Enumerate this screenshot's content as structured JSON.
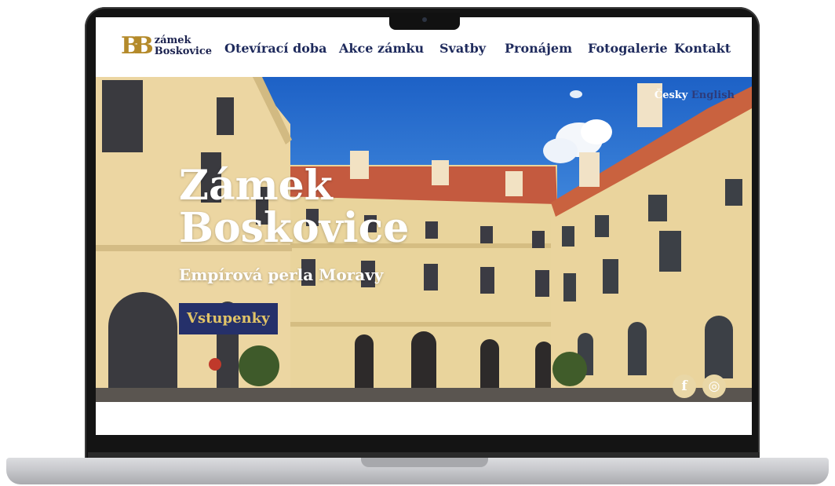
{
  "site": {
    "logo_mark": "B",
    "logo_line1": "zámek",
    "logo_line2": "Boskovice"
  },
  "nav": {
    "items": [
      {
        "label": "Otevírací doba"
      },
      {
        "label": "Akce zámku"
      },
      {
        "label": "Svatby"
      },
      {
        "label": "Pronájem"
      },
      {
        "label": "Fotogalerie"
      },
      {
        "label": "Kontakt"
      }
    ]
  },
  "language": {
    "cs": "Česky",
    "en": "English"
  },
  "hero": {
    "title_line1": "Zámek",
    "title_line2": "Boskovice",
    "subtitle": "Empírová perla Moravy",
    "cta_label": "Vstupenky"
  },
  "social": {
    "facebook_icon": "facebook-icon",
    "instagram_icon": "instagram-icon",
    "facebook_glyph": "f",
    "instagram_glyph": "◎"
  },
  "colors": {
    "brand_navy": "#1e2a5c",
    "brand_gold": "#b48a2a",
    "cta_bg": "#25306a",
    "cta_text": "#e2c467"
  }
}
